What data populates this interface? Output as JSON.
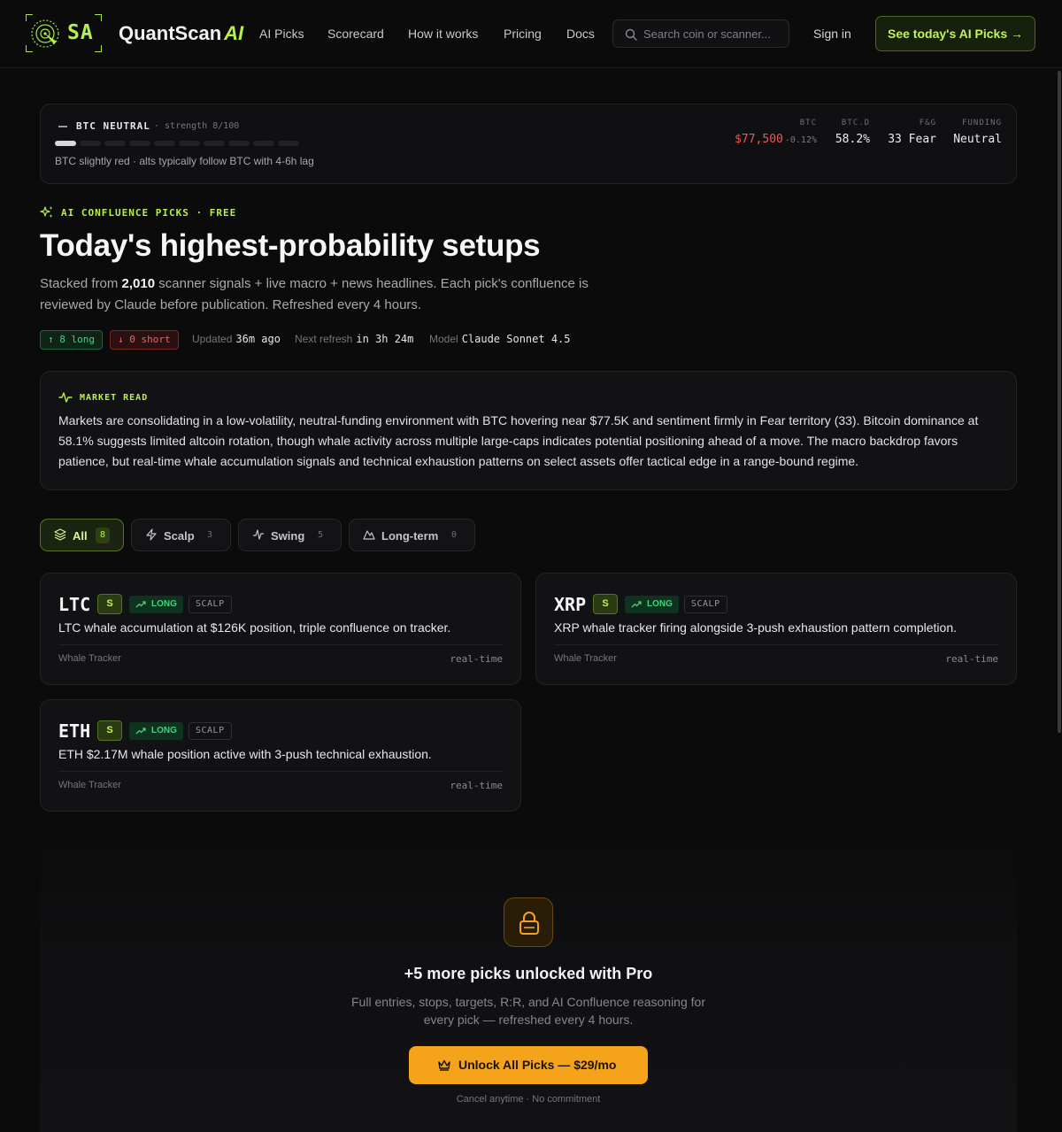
{
  "header": {
    "logo_letters": "SA",
    "brand_name": "QuantScan",
    "brand_suffix": "AI",
    "nav": [
      "AI Picks",
      "Scorecard",
      "How it works",
      "Pricing",
      "Docs"
    ],
    "search_placeholder": "Search coin or scanner...",
    "signin_label": "Sign in",
    "cta_label": "See today's AI Picks →"
  },
  "btc": {
    "title": "BTC NEUTRAL",
    "strength": "· strength 8/100",
    "strength_value": 8,
    "note": "BTC slightly red · alts typically follow BTC with 4-6h lag",
    "stats": {
      "btc_label": "BTC",
      "btc_price": "$77,500",
      "btc_change": "-0.12%",
      "dom_label": "BTC.D",
      "dom_value": "58.2%",
      "fg_label": "F&G",
      "fg_value": "33 Fear",
      "funding_label": "FUNDING",
      "funding_value": "Neutral"
    }
  },
  "hero": {
    "eyebrow": "AI CONFLUENCE PICKS · FREE",
    "title": "Today's highest-probability setups",
    "sub_pre": "Stacked from ",
    "sub_count": "2,010",
    "sub_post": " scanner signals + live macro + news headlines. Each pick's confluence is reviewed by Claude before publication. Refreshed every 4 hours.",
    "long_pill": "↑ 8 long",
    "short_pill": "↓ 0 short",
    "updated_label": "Updated",
    "updated_value": "36m ago",
    "refresh_label": "Next refresh",
    "refresh_value": "in 3h 24m",
    "model_label": "Model",
    "model_value": "Claude Sonnet 4.5"
  },
  "market": {
    "heading": "MARKET READ",
    "text": "Markets are consolidating in a low-volatility, neutral-funding environment with BTC hovering near $77.5K and sentiment firmly in Fear territory (33). Bitcoin dominance at 58.1% suggests limited altcoin rotation, though whale activity across multiple large-caps indicates potential positioning ahead of a move. The macro backdrop favors patience, but real-time whale accumulation signals and technical exhaustion patterns on select assets offer tactical edge in a range-bound regime."
  },
  "tabs": [
    {
      "label": "All",
      "count": "8"
    },
    {
      "label": "Scalp",
      "count": "3"
    },
    {
      "label": "Swing",
      "count": "5"
    },
    {
      "label": "Long-term",
      "count": "0"
    }
  ],
  "picks": [
    {
      "symbol": "LTC",
      "grade": "S",
      "direction": "LONG",
      "horizon": "SCALP",
      "desc": "LTC whale accumulation at $126K position, triple confluence on tracker.",
      "source": "Whale Tracker",
      "time": "real-time"
    },
    {
      "symbol": "XRP",
      "grade": "S",
      "direction": "LONG",
      "horizon": "SCALP",
      "desc": "XRP whale tracker firing alongside 3-push exhaustion pattern completion.",
      "source": "Whale Tracker",
      "time": "real-time"
    },
    {
      "symbol": "ETH",
      "grade": "S",
      "direction": "LONG",
      "horizon": "SCALP",
      "desc": "ETH $2.17M whale position active with 3-push technical exhaustion.",
      "source": "Whale Tracker",
      "time": "real-time"
    }
  ],
  "pro": {
    "title": "+5 more picks unlocked with Pro",
    "sub": "Full entries, stops, targets, R:R, and AI Confluence reasoning for every pick — refreshed every 4 hours.",
    "button": "Unlock All Picks — $29/mo",
    "note": "Cancel anytime · No commitment"
  },
  "colors": {
    "accent": "#b5f04a",
    "long": "#3fd67a",
    "short": "#f06060",
    "pro": "#f5a31a"
  },
  "icons": [
    "search-icon",
    "sparkles-icon",
    "pulse-icon",
    "layers-icon",
    "bolt-icon",
    "zigzag-icon",
    "mountain-icon",
    "trend-up-icon",
    "lock-icon",
    "crown-icon"
  ]
}
